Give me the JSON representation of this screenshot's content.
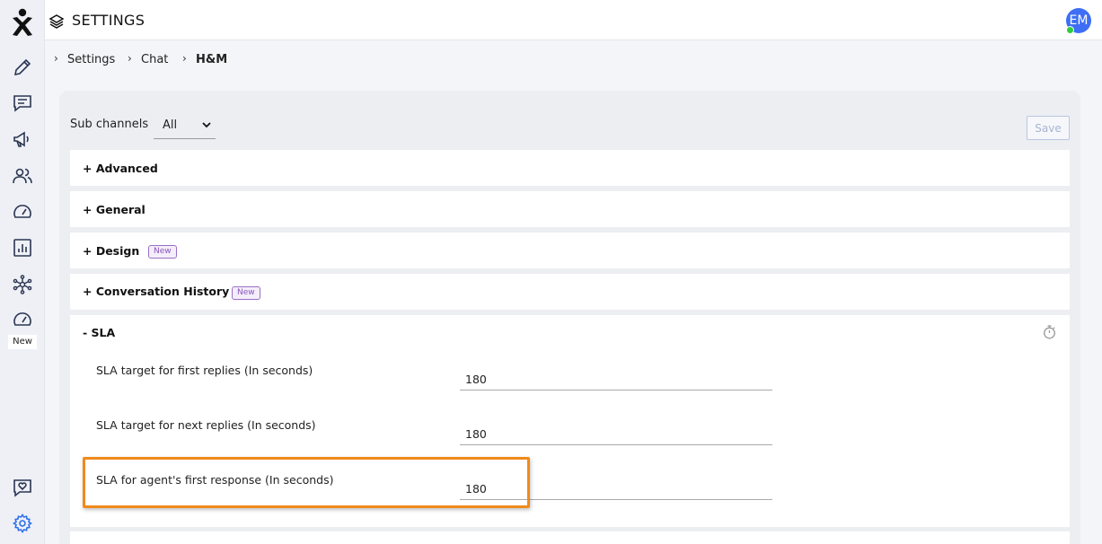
{
  "header": {
    "title": "SETTINGS",
    "avatar_initials": "EM"
  },
  "sidebar": {
    "new_label": "New"
  },
  "breadcrumb": {
    "items": [
      "Settings",
      "Chat",
      "H&M"
    ]
  },
  "subchannels": {
    "label": "Sub channels",
    "value": "All"
  },
  "toolbar": {
    "save_label": "Save"
  },
  "sections": [
    {
      "label": "+ Advanced",
      "badge": ""
    },
    {
      "label": "+ General",
      "badge": ""
    },
    {
      "label": "+ Design",
      "badge": "New"
    },
    {
      "label": "+ Conversation History",
      "badge": "New"
    },
    {
      "label": "- SLA",
      "badge": ""
    }
  ],
  "sla": {
    "fields": [
      {
        "label": "SLA target for first replies (In seconds)",
        "value": "180"
      },
      {
        "label": "SLA target for next replies (In seconds)",
        "value": "180"
      },
      {
        "label": "SLA for agent's first response (In seconds)",
        "value": "180"
      }
    ]
  },
  "colors": {
    "accent": "#3d6ef5",
    "highlight": "#f08a1c",
    "badge": "#8a55c0",
    "online": "#2ecc40"
  }
}
